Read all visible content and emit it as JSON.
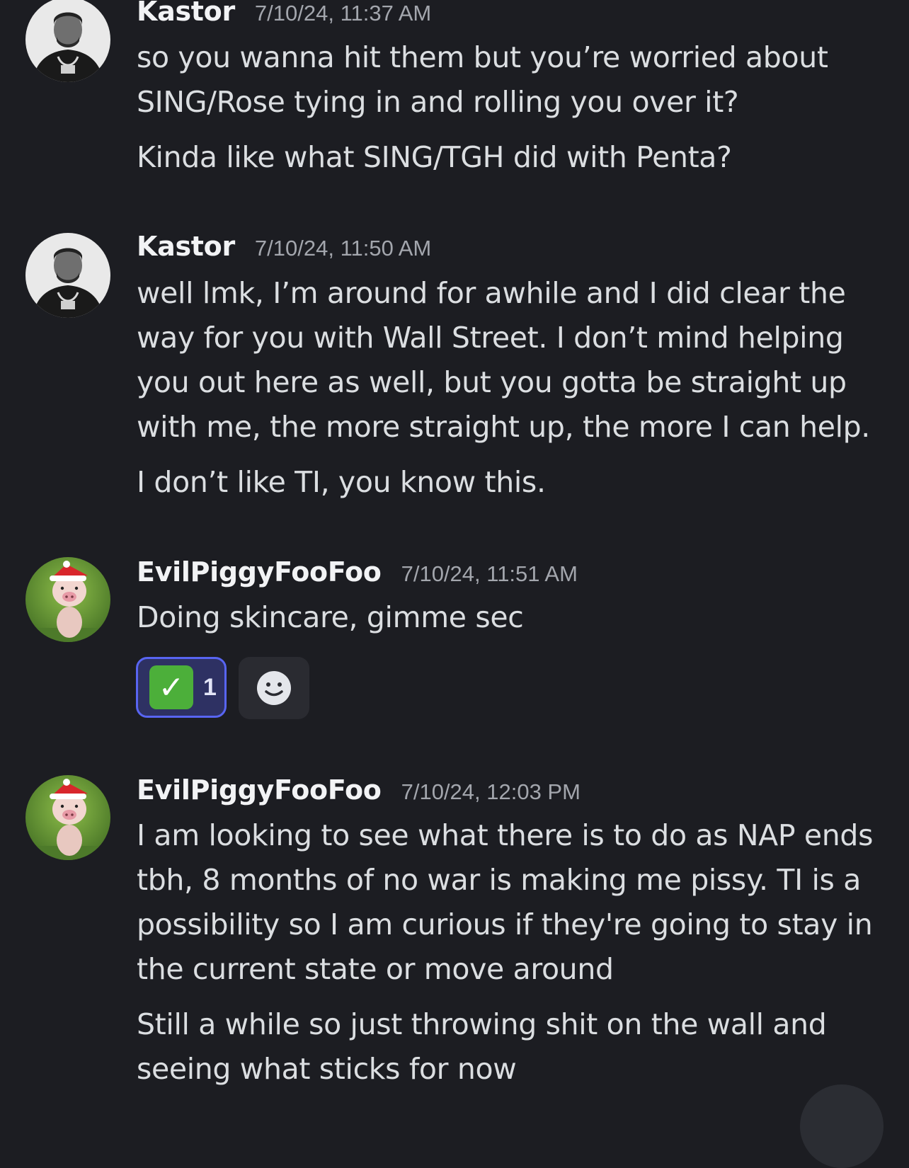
{
  "messages": [
    {
      "author": "Kastor",
      "timestamp": "7/10/24, 11:37 AM",
      "avatar_icon": "person-avatar-icon",
      "lines": [
        "so you wanna hit them but you’re worried about",
        "SING/Rose tying in and rolling you over it?"
      ],
      "followup": [
        "Kinda like what SING/TGH did with Penta?"
      ]
    },
    {
      "author": "Kastor",
      "timestamp": "7/10/24, 11:50 AM",
      "avatar_icon": "person-avatar-icon",
      "lines": [
        "well lmk, I’m around for awhile and I did clear the",
        "way for you with Wall Street. I don’t mind helping",
        "you out here as well, but you gotta be straight up",
        "with me, the more straight up, the more I can help."
      ],
      "followup": [
        "I don’t like TI, you know this."
      ]
    },
    {
      "author": "EvilPiggyFooFoo",
      "timestamp": "7/10/24, 11:51 AM",
      "avatar_icon": "piglet-santa-hat-avatar-icon",
      "lines": [
        "Doing skincare, gimme sec"
      ],
      "reactions": [
        {
          "emoji_icon": "white-check-mark-icon",
          "count": "1",
          "selected": true
        }
      ],
      "add_reaction_icon": "smiley-add-reaction-icon"
    },
    {
      "author": "EvilPiggyFooFoo",
      "timestamp": "7/10/24, 12:03 PM",
      "avatar_icon": "piglet-santa-hat-avatar-icon",
      "lines": [
        "I am looking to see what there is to do as NAP ends",
        "tbh, 8 months of no war is making me pissy. TI is a",
        "possibility so I am curious if they're going to stay in",
        "the current state or move around"
      ],
      "followup": [
        "Still a while so just throwing shit on the wall and",
        "seeing what sticks for now"
      ]
    }
  ],
  "colors": {
    "background": "#1c1d22",
    "username": "#f2f3f5",
    "timestamp": "#a3a6ad",
    "message_text": "#dbdee1",
    "reaction_selected_border": "#5865f2",
    "reaction_selected_bg": "#2e3163"
  }
}
